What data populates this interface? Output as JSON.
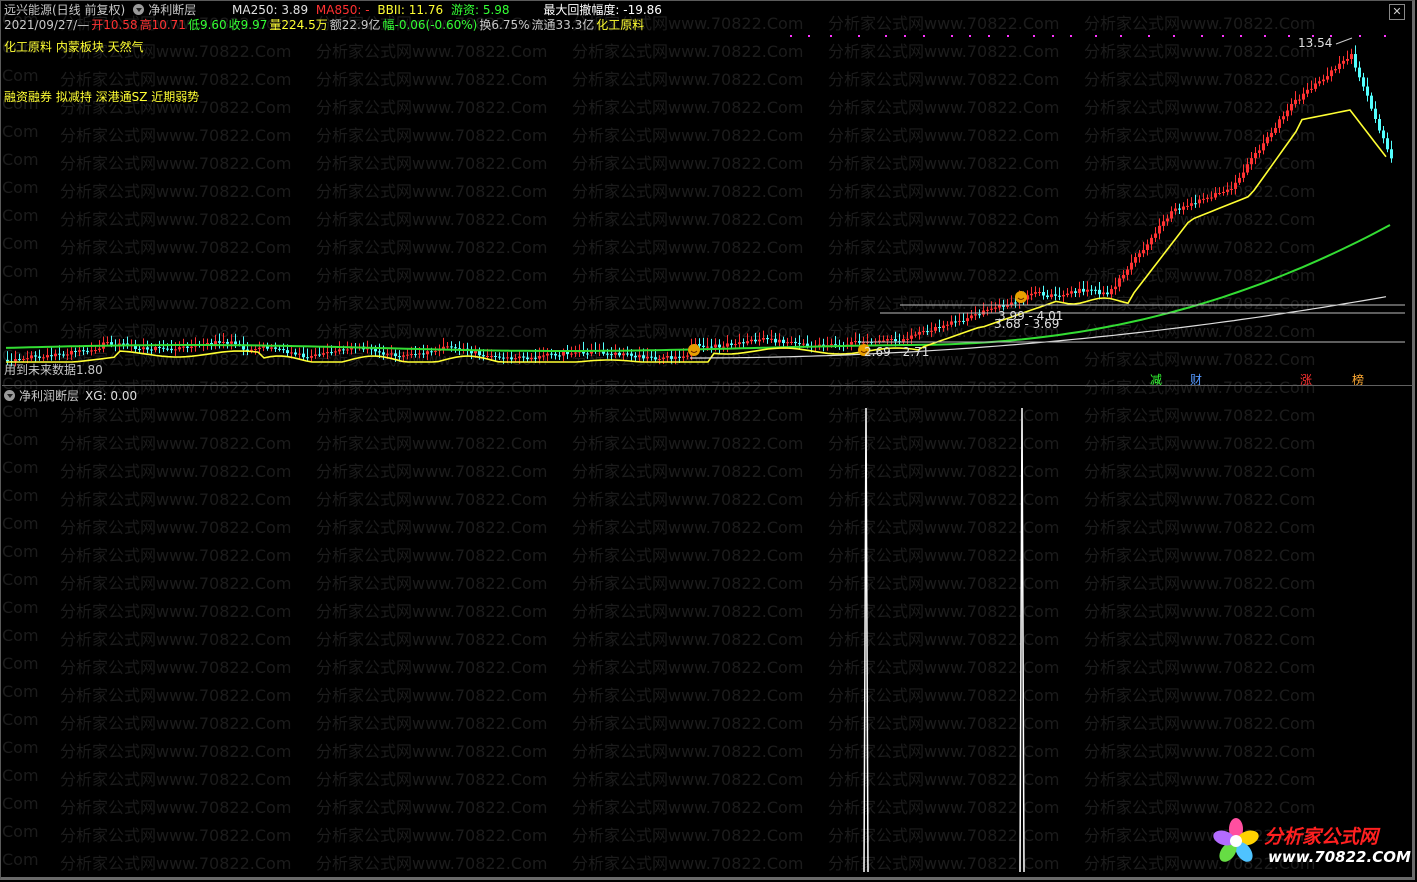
{
  "header": {
    "stock_name": "远兴能源(日线 前复权)",
    "indicator_name": "净利断层",
    "ma250_label": "MA250: 3.89",
    "ma850_label": "MA850: -",
    "bbii_label": "BBII: 11.76",
    "youzi_label": "游资: 5.98",
    "max_drawdown_label": "最大回撤幅度: -19.86"
  },
  "quote": {
    "date": "2021/09/27/—",
    "open": "开10.58",
    "high": "高10.71",
    "low": "低9.60",
    "close": "收9.97",
    "volume": "量224.5万",
    "amount": "额22.9亿",
    "change": "幅-0.06(-0.60%)",
    "turnover": "换6.75%",
    "float": "流通33.3亿",
    "sector": "化工原料"
  },
  "tags_line1": "化工原料 内蒙板块 天然气",
  "tags_line2": "融资融券 拟减持 深港通SZ 近期弱势",
  "left_note": "用到未来数据1.80",
  "labels": {
    "peak": "13.54",
    "range1": "3.99 - 4.01",
    "range2": "3.68 - 3.69",
    "range3": "2.69 - 2.71"
  },
  "bottom_tags": [
    "减",
    "财",
    "涨",
    "榜"
  ],
  "sub_panel": {
    "title": "净利润断层",
    "value_label": "XG: 0.00"
  },
  "watermark": {
    "text": "分析家公式网www.70822.Com",
    "edge_text": "Com"
  },
  "logo": {
    "name": "分析家公式网",
    "url": "www.70822.COM"
  },
  "colors": {
    "up": "#ff3232",
    "down": "#54ffff",
    "yellow": "#ffff33",
    "green": "#33dd33",
    "white": "#ffffff",
    "magenta": "#ff33ff"
  }
}
